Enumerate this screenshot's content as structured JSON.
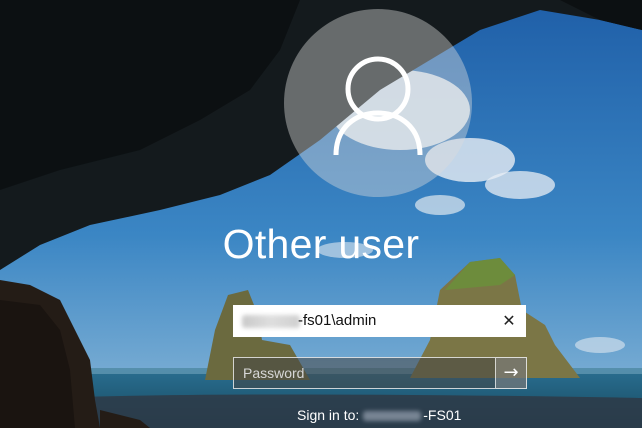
{
  "login": {
    "title": "Other user",
    "username_value": "-fs01\\admin",
    "password_placeholder": "Password",
    "signin_prefix": "Sign in to:",
    "signin_machine": "-FS01"
  },
  "icons": {
    "avatar": "user-icon",
    "clear": "close-icon",
    "submit": "arrow-right-icon"
  },
  "colors": {
    "avatar_circle": "#c8c8c8",
    "sky": "#2b6fae",
    "sea": "#1e5f86"
  }
}
